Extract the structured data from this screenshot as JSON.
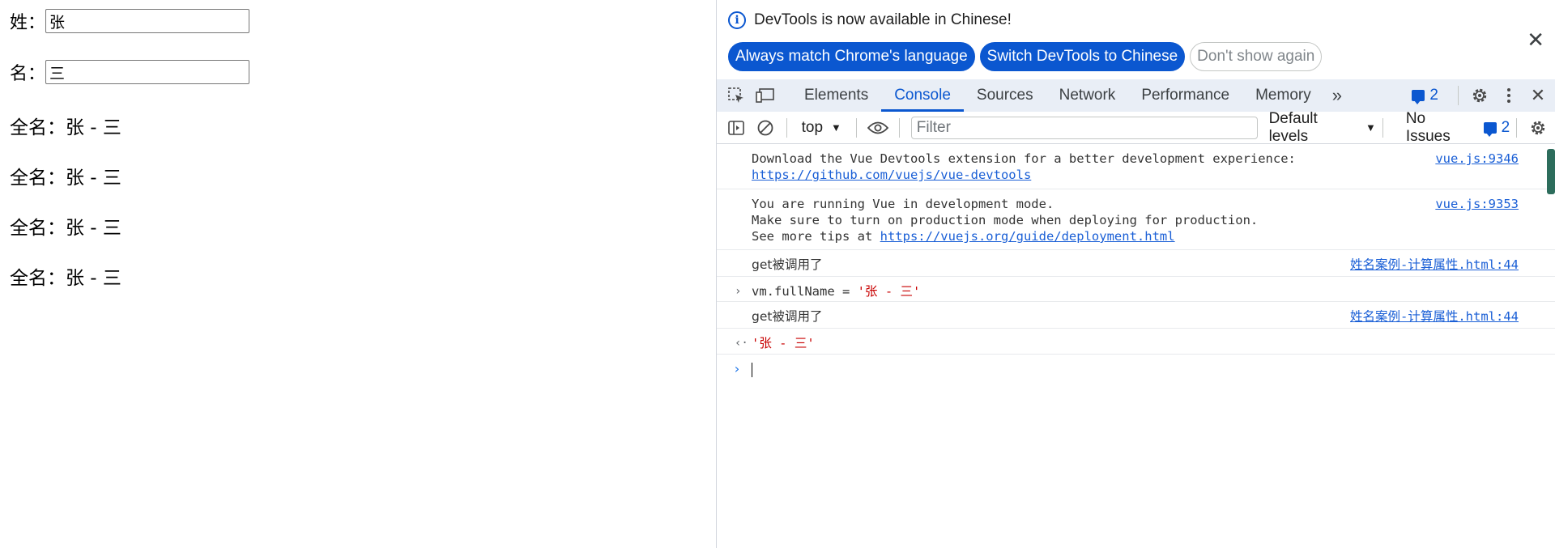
{
  "page": {
    "last_name_label": "姓：",
    "last_name_value": "张",
    "first_name_label": "名：",
    "first_name_value": "三",
    "fullnames": [
      "全名：张 - 三",
      "全名：张 - 三",
      "全名：张 - 三",
      "全名：张 - 三"
    ]
  },
  "devtools": {
    "banner": {
      "message": "DevTools is now available in Chinese!",
      "btn_match": "Always match Chrome's language",
      "btn_switch": "Switch DevTools to Chinese",
      "btn_dismiss": "Don't show again"
    },
    "tabs": [
      "Elements",
      "Console",
      "Sources",
      "Network",
      "Performance",
      "Memory"
    ],
    "active_tab": "Console",
    "message_count": "2",
    "toolbar": {
      "context": "top",
      "filter_placeholder": "Filter",
      "levels": "Default levels",
      "issues_label": "No Issues",
      "issues_count": "2"
    },
    "console": {
      "l1_text": "Download the Vue Devtools extension for a better development experience:",
      "l1_link": "https://github.com/vuejs/vue-devtools",
      "l1_src": "vue.js:9346",
      "l2_text1": "You are running Vue in development mode.",
      "l2_text2": "Make sure to turn on production mode when deploying for production.",
      "l2_text3": "See more tips at ",
      "l2_link": "https://vuejs.org/guide/deployment.html",
      "l2_src": "vue.js:9353",
      "l3_text": "get被调用了",
      "l3_src": "姓名案例-计算属性.html:44",
      "l4_text": "vm.fullName = ",
      "l4_str": "'张 - 三'",
      "l5_text": "get被调用了",
      "l5_src": "姓名案例-计算属性.html:44",
      "l6_str": "'张 - 三'"
    }
  },
  "colors": {
    "accent": "#0b57d0",
    "tabbar_bg": "#e9eef6",
    "string": "#c80000"
  }
}
